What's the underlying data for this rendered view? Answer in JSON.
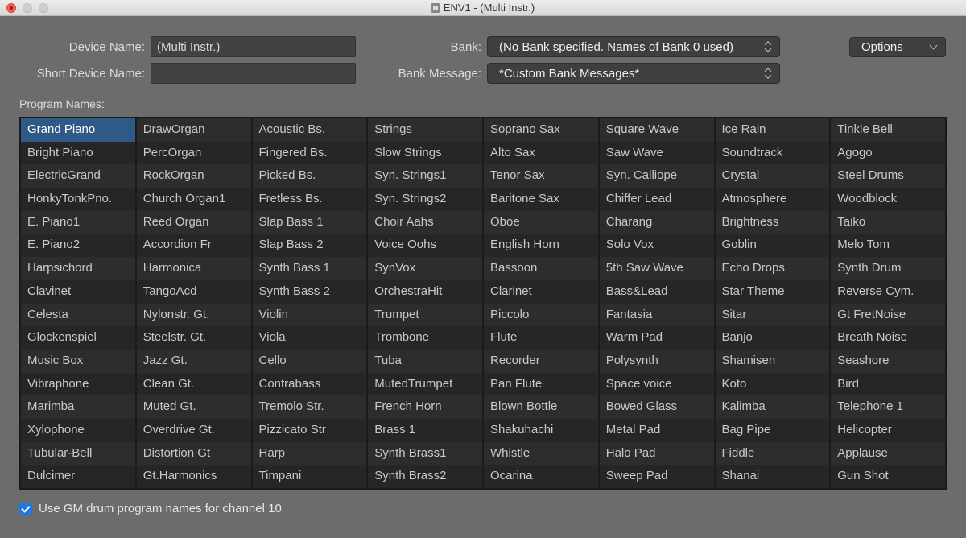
{
  "window": {
    "title": "ENV1 - (Multi Instr.)"
  },
  "device": {
    "name_label": "Device Name:",
    "name_value": "(Multi Instr.)",
    "short_label": "Short Device Name:",
    "short_value": ""
  },
  "bank": {
    "label": "Bank:",
    "value": "(No Bank specified. Names of Bank 0 used)",
    "message_label": "Bank Message:",
    "message_value": "*Custom Bank Messages*"
  },
  "options": {
    "label": "Options"
  },
  "programs": {
    "label": "Program Names:",
    "selected_index": 0,
    "names": [
      "Grand Piano",
      "Bright Piano",
      "ElectricGrand",
      "HonkyTonkPno.",
      "E. Piano1",
      "E. Piano2",
      "Harpsichord",
      "Clavinet",
      "Celesta",
      "Glockenspiel",
      "Music Box",
      "Vibraphone",
      "Marimba",
      "Xylophone",
      "Tubular-Bell",
      "Dulcimer",
      "DrawOrgan",
      "PercOrgan",
      "RockOrgan",
      "Church Organ1",
      "Reed Organ",
      "Accordion Fr",
      "Harmonica",
      "TangoAcd",
      "Nylonstr. Gt.",
      "Steelstr. Gt.",
      "Jazz Gt.",
      "Clean Gt.",
      "Muted Gt.",
      "Overdrive Gt.",
      "Distortion Gt",
      "Gt.Harmonics",
      "Acoustic Bs.",
      "Fingered Bs.",
      "Picked Bs.",
      "Fretless Bs.",
      "Slap Bass 1",
      "Slap Bass 2",
      "Synth Bass 1",
      "Synth Bass 2",
      "Violin",
      "Viola",
      "Cello",
      "Contrabass",
      "Tremolo Str.",
      "Pizzicato Str",
      "Harp",
      "Timpani",
      "Strings",
      "Slow Strings",
      "Syn. Strings1",
      "Syn. Strings2",
      "Choir Aahs",
      "Voice Oohs",
      "SynVox",
      "OrchestraHit",
      "Trumpet",
      "Trombone",
      "Tuba",
      "MutedTrumpet",
      "French Horn",
      "Brass 1",
      "Synth Brass1",
      "Synth Brass2",
      "Soprano Sax",
      "Alto Sax",
      "Tenor Sax",
      "Baritone Sax",
      "Oboe",
      "English Horn",
      "Bassoon",
      "Clarinet",
      "Piccolo",
      "Flute",
      "Recorder",
      "Pan Flute",
      "Blown Bottle",
      "Shakuhachi",
      "Whistle",
      "Ocarina",
      "Square Wave",
      "Saw Wave",
      "Syn. Calliope",
      "Chiffer Lead",
      "Charang",
      "Solo Vox",
      "5th Saw Wave",
      "Bass&Lead",
      "Fantasia",
      "Warm Pad",
      "Polysynth",
      "Space voice",
      "Bowed Glass",
      "Metal Pad",
      "Halo Pad",
      "Sweep Pad",
      "Ice Rain",
      "Soundtrack",
      "Crystal",
      "Atmosphere",
      "Brightness",
      "Goblin",
      "Echo Drops",
      "Star Theme",
      "Sitar",
      "Banjo",
      "Shamisen",
      "Koto",
      "Kalimba",
      "Bag Pipe",
      "Fiddle",
      "Shanai",
      "Tinkle Bell",
      "Agogo",
      "Steel Drums",
      "Woodblock",
      "Taiko",
      "Melo Tom",
      "Synth Drum",
      "Reverse Cym.",
      "Gt FretNoise",
      "Breath Noise",
      "Seashore",
      "Bird",
      "Telephone 1",
      "Helicopter",
      "Applause",
      "Gun Shot"
    ]
  },
  "gm_drums": {
    "label": "Use GM drum program names for channel 10",
    "checked": true
  },
  "colors": {
    "accent": "#1e78e0",
    "selection": "#2f5a87"
  }
}
